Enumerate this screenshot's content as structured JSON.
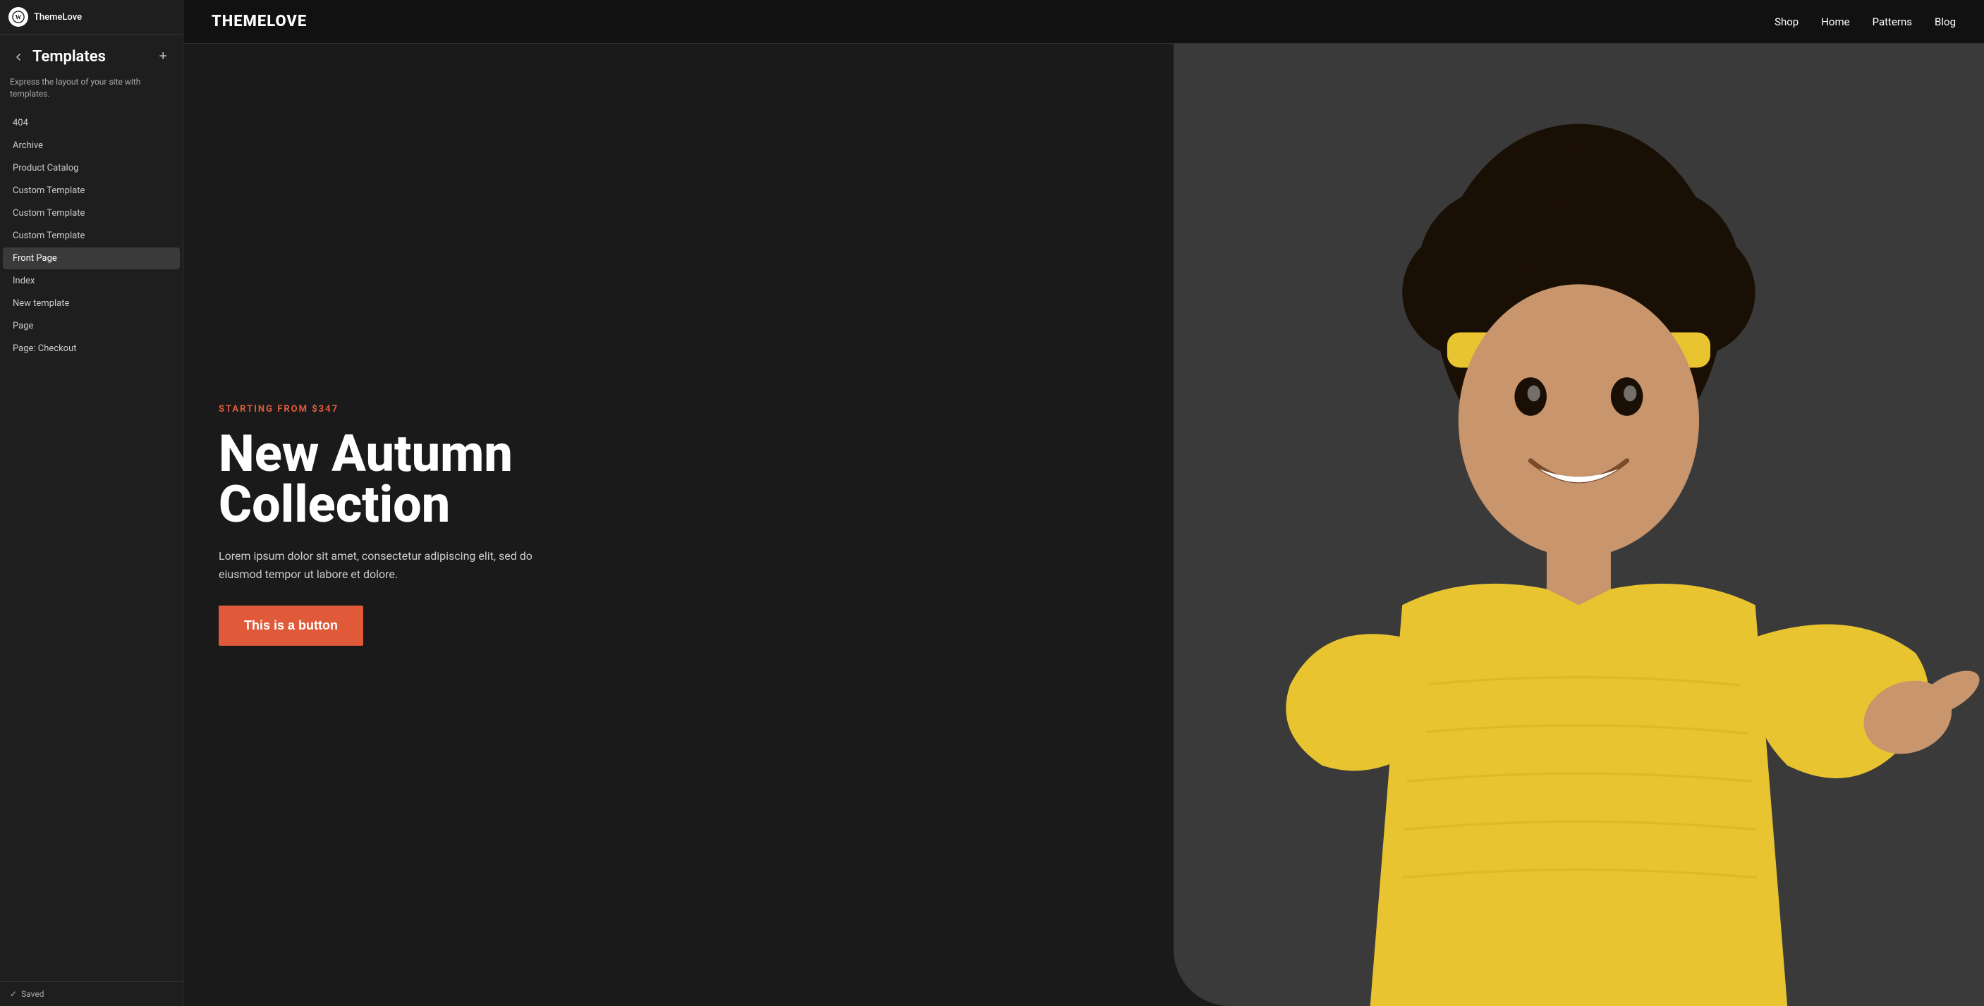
{
  "app": {
    "logo_label": "ThemeloveLogo",
    "site_name": "ThemeLove"
  },
  "sidebar": {
    "title": "Templates",
    "description": "Express the layout of your site with templates.",
    "add_button_label": "+",
    "items": [
      {
        "label": "404",
        "id": "404",
        "active": false
      },
      {
        "label": "Archive",
        "id": "archive",
        "active": false
      },
      {
        "label": "Product Catalog",
        "id": "product-catalog",
        "active": false
      },
      {
        "label": "Custom Template",
        "id": "custom-template-1",
        "active": false
      },
      {
        "label": "Custom Template",
        "id": "custom-template-2",
        "active": false
      },
      {
        "label": "Custom Template",
        "id": "custom-template-3",
        "active": false
      },
      {
        "label": "Front Page",
        "id": "front-page",
        "active": true
      },
      {
        "label": "Index",
        "id": "index",
        "active": false
      },
      {
        "label": "New template",
        "id": "new-template",
        "active": false
      },
      {
        "label": "Page",
        "id": "page",
        "active": false
      },
      {
        "label": "Page: Checkout",
        "id": "page-checkout",
        "active": false
      }
    ],
    "footer": {
      "status": "Saved"
    }
  },
  "preview": {
    "header": {
      "logo": "THEMELOVE",
      "nav_items": [
        "Shop",
        "Home",
        "Patterns",
        "Blog"
      ]
    },
    "hero": {
      "tagline": "STARTING FROM $347",
      "title_line1": "New Autumn",
      "title_line2": "Collection",
      "body": "Lorem ipsum dolor sit amet, consectetur adipiscing elit, sed do eiusmod tempor ut labore et dolore.",
      "button_label": "This is a button"
    }
  },
  "colors": {
    "accent_orange": "#e05a3a",
    "button_bg": "#e05a3a",
    "site_bg": "#1a1a1a",
    "sidebar_bg": "#1e1e1e",
    "active_item_bg": "#3a3a3a",
    "header_bg": "#111111"
  }
}
